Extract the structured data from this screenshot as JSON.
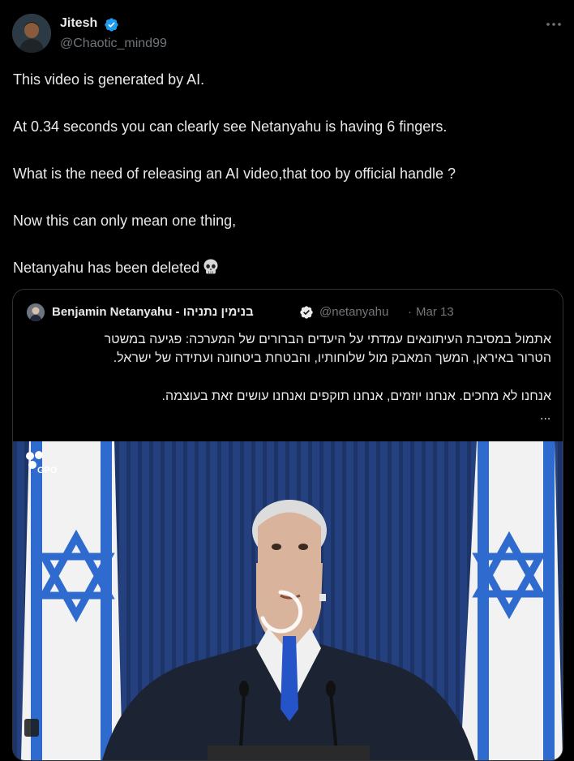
{
  "author": {
    "name": "Jitesh",
    "handle": "@Chaotic_mind99"
  },
  "tweet": {
    "lines": [
      "This video is generated by AI.",
      "At 0.34 seconds you can clearly see Netanyahu is having 6 fingers.",
      "What is the need of releasing an AI video,that too by official handle ?",
      "Now this can only mean one thing,",
      "Netanyahu has been deleted"
    ],
    "emoji": "skull-icon"
  },
  "quote": {
    "name": "Benjamin Netanyahu - בנימין נתניהו",
    "handle": "@netanyahu",
    "separator": "·",
    "date": "Mar 13",
    "text_lines": [
      "אתמול במסיבת העיתונאים עמדתי על היעדים הברורים של המערכה: פגיעה במשטר",
      "הטרור באיראן, המשך המאבק מול שלוחותיו, והבטחת ביטחונה ועתידה של ישראל.",
      "אנחנו לא מחכים. אנחנו יוזמים, אנחנו תוקפים ואנחנו עושים זאת בעוצמה."
    ],
    "ellipsis": "...",
    "media_watermark": "GPO"
  },
  "colors": {
    "background": "#000000",
    "text": "#e7e9ea",
    "secondary_text": "#71767b",
    "verified": "#1d9bf0",
    "border": "#2f3336"
  }
}
